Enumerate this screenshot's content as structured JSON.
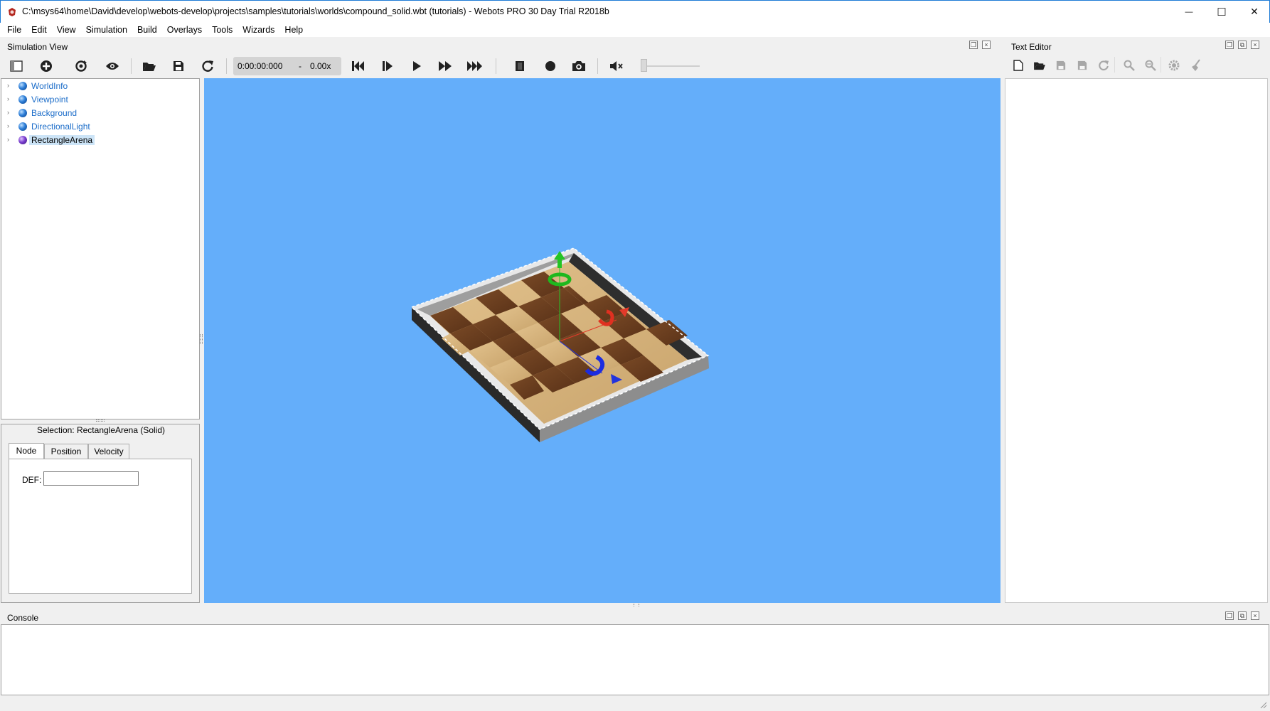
{
  "window": {
    "title": "C:\\msys64\\home\\David\\develop\\webots-develop\\projects\\samples\\tutorials\\worlds\\compound_solid.wbt (tutorials) - Webots PRO 30 Day Trial R2018b",
    "minimize_glyph": "—",
    "maximize_glyph": "☐",
    "close_glyph": "✕"
  },
  "menu": [
    "File",
    "Edit",
    "View",
    "Simulation",
    "Build",
    "Overlays",
    "Tools",
    "Wizards",
    "Help"
  ],
  "docks": {
    "simulation_view": "Simulation View",
    "text_editor": "Text Editor",
    "console": "Console"
  },
  "toolbar": {
    "time": "0:00:00:000",
    "separator": "-",
    "speed": "0.00x",
    "volume_level": 0
  },
  "scene_tree": {
    "items": [
      {
        "label": "WorldInfo",
        "color": "blue"
      },
      {
        "label": "Viewpoint",
        "color": "blue"
      },
      {
        "label": "Background",
        "color": "blue"
      },
      {
        "label": "DirectionalLight",
        "color": "blue"
      },
      {
        "label": "RectangleArena",
        "color": "purple",
        "selected": true
      }
    ]
  },
  "field_editor": {
    "selection": "Selection: RectangleArena (Solid)",
    "tabs": [
      "Node",
      "Position",
      "Velocity"
    ],
    "active_tab": "Node",
    "def_label": "DEF:",
    "def_value": ""
  },
  "colors": {
    "background_3d": "#64aefa",
    "tree_link": "#1c6dc9",
    "selection": "#cce4f7"
  }
}
